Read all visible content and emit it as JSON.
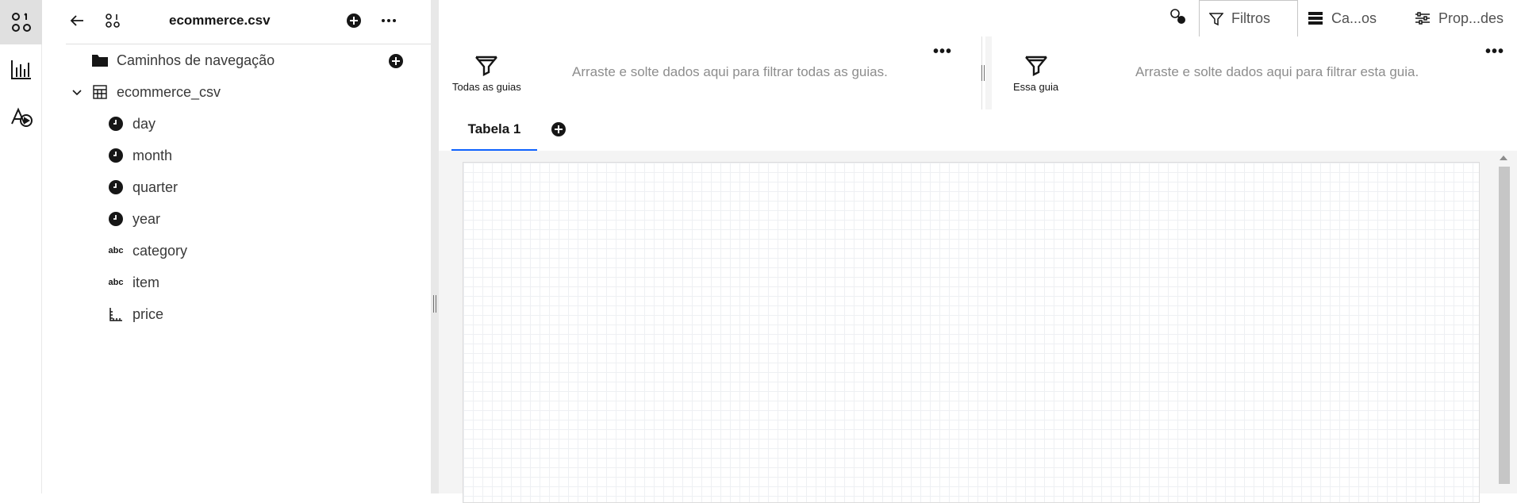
{
  "rail": {
    "items": [
      {
        "name": "data-sources-icon",
        "active": true
      },
      {
        "name": "visualizations-icon",
        "active": false
      },
      {
        "name": "assets-icon",
        "active": false
      }
    ]
  },
  "panel": {
    "title": "ecommerce.csv",
    "folder_label": "Caminhos de navegação",
    "table_label": "ecommerce_csv",
    "fields": [
      {
        "label": "day",
        "icon": "clock-icon"
      },
      {
        "label": "month",
        "icon": "clock-icon"
      },
      {
        "label": "quarter",
        "icon": "clock-icon"
      },
      {
        "label": "year",
        "icon": "clock-icon"
      },
      {
        "label": "category",
        "icon": "abc-icon"
      },
      {
        "label": "item",
        "icon": "abc-icon"
      },
      {
        "label": "price",
        "icon": "measure-icon"
      }
    ],
    "abc_glyph": "abc"
  },
  "topbar": {
    "filtros": "Filtros",
    "campos": "Ca...os",
    "propriedades": "Prop...des"
  },
  "filters": {
    "all_tabs_label": "Todas as guias",
    "all_tabs_hint": "Arraste e solte dados aqui para filtrar todas as guias.",
    "this_tab_label": "Essa guia",
    "this_tab_hint": "Arraste e solte dados aqui para filtrar esta guia.",
    "more": "•••"
  },
  "tabs": {
    "items": [
      {
        "label": "Tabela 1",
        "active": true
      }
    ]
  },
  "colors": {
    "accent": "#0f62fe",
    "text": "#161616",
    "muted": "#8d8d8d"
  }
}
